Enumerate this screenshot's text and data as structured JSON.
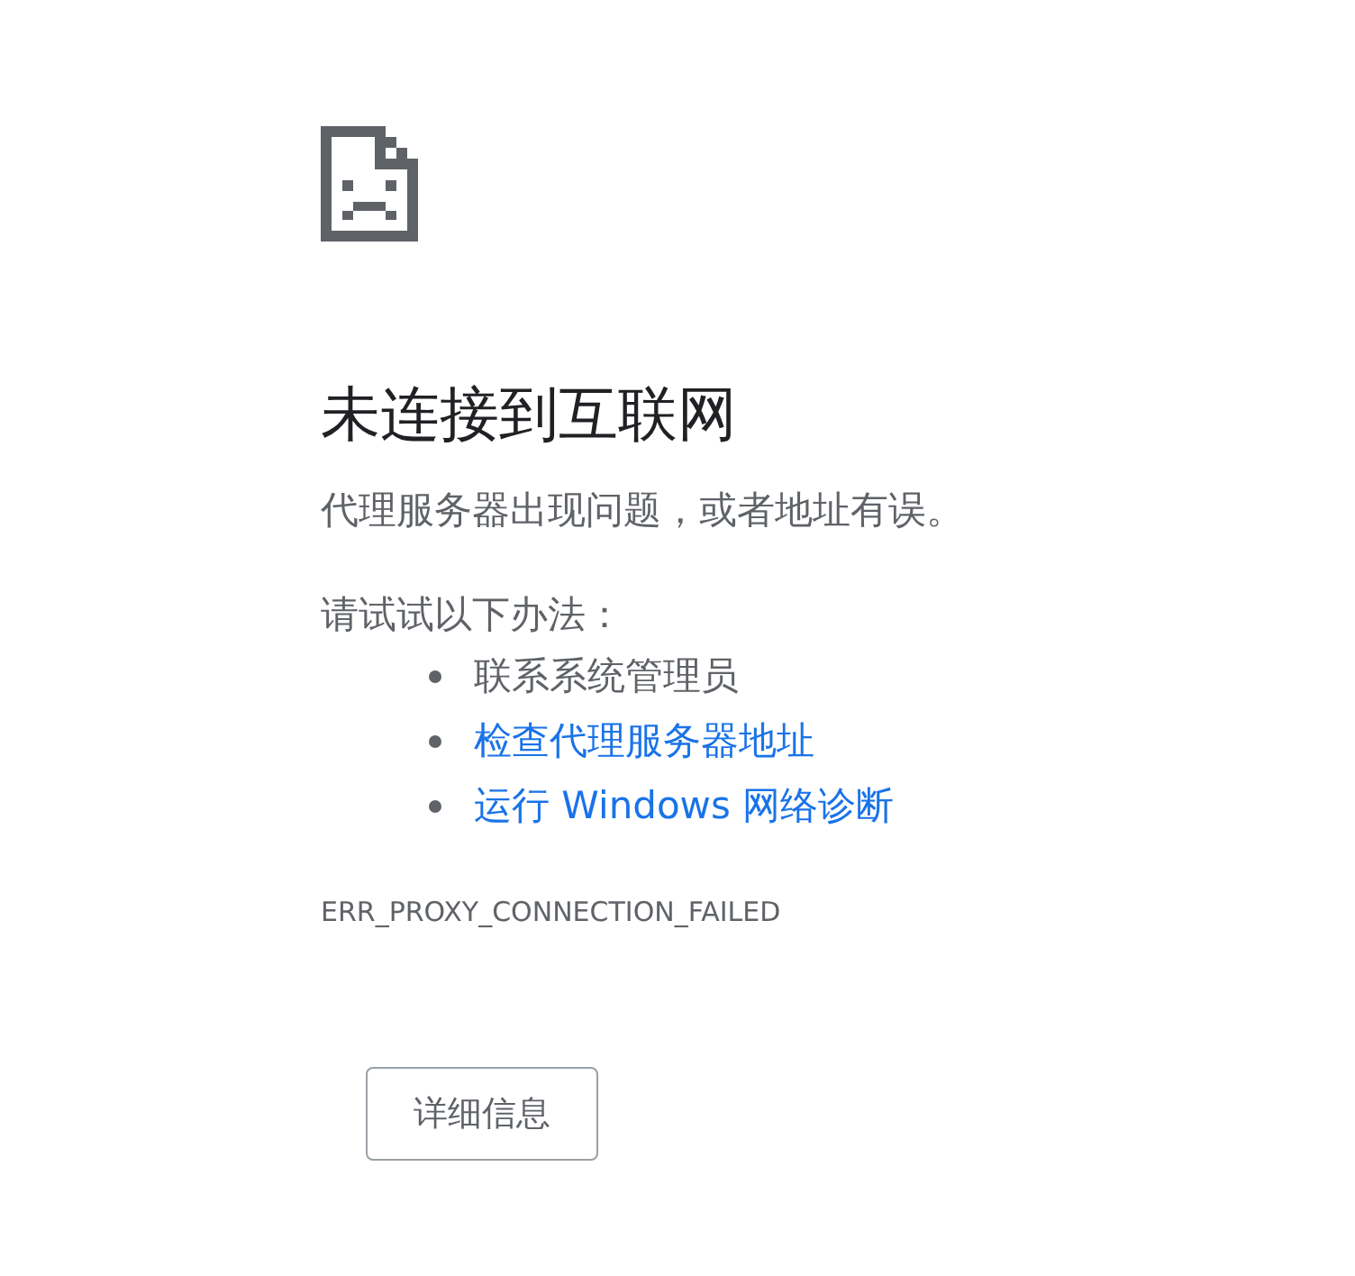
{
  "title": "未连接到互联网",
  "message": "代理服务器出现问题，或者地址有误。",
  "suggestions_heading": "请试试以下办法：",
  "suggestions": [
    {
      "text": "联系系统管理员",
      "kind": "text"
    },
    {
      "text": "检查代理服务器地址",
      "kind": "link"
    },
    {
      "text": "运行 Windows 网络诊断",
      "kind": "link"
    }
  ],
  "error_code": "ERR_PROXY_CONNECTION_FAILED",
  "details_button": "详细信息"
}
